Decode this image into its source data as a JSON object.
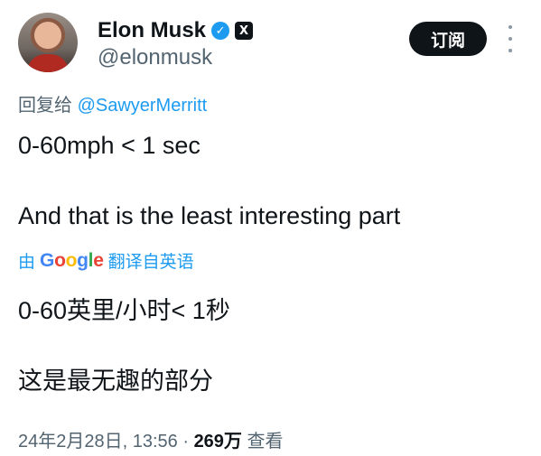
{
  "author": {
    "name": "Elon Musk",
    "handle": "@elonmusk",
    "verified_icon": "verified-badge-icon",
    "affiliate_icon": "x-logo-icon"
  },
  "actions": {
    "subscribe_label": "订阅",
    "more_icon": "more-vertical-icon"
  },
  "reply": {
    "prefix": "回复给",
    "mention": "@SawyerMerritt"
  },
  "tweet": {
    "line1": "0-60mph < 1 sec",
    "line2": "And that is the least interesting part"
  },
  "translation": {
    "prefix": "由",
    "brand": {
      "G": "G",
      "o1": "o",
      "o2": "o",
      "g": "g",
      "l": "l",
      "e": "e"
    },
    "suffix": "翻译自英语",
    "line1": "0-60英里/小时< 1秒",
    "line2": "这是最无趣的部分"
  },
  "meta": {
    "date": "24年2月28日, 13:56",
    "separator": " · ",
    "views": "269万",
    "views_label": " 查看"
  },
  "colors": {
    "accent": "#1d9bf0",
    "text": "#0f1419",
    "secondary": "#536471"
  }
}
